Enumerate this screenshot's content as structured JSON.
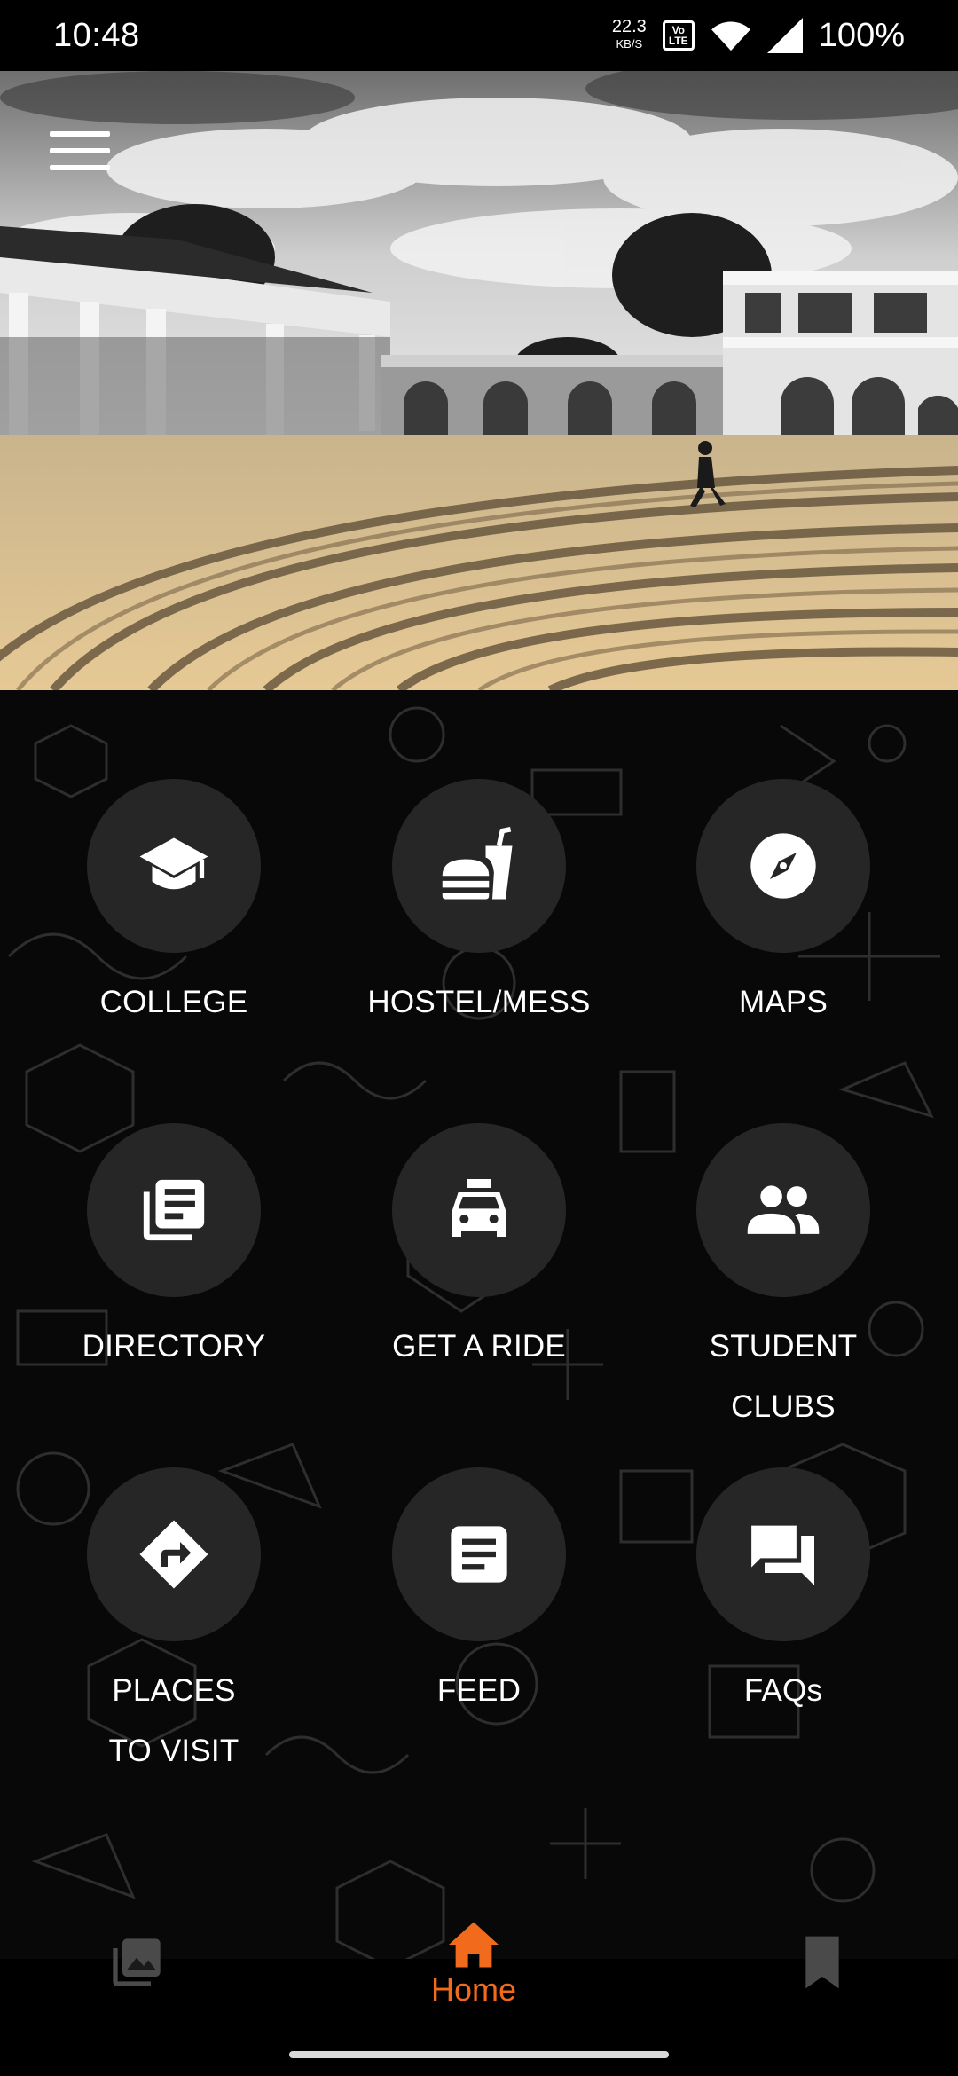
{
  "status_bar": {
    "time": "10:48",
    "net_speed_value": "22.3",
    "net_speed_unit": "KB/S",
    "volte_top": "Vo",
    "volte_bottom": "LTE",
    "battery": "100%"
  },
  "hero": {
    "menu_icon": "hamburger-menu-icon"
  },
  "grid": {
    "items": [
      {
        "label": "COLLEGE",
        "icon": "graduation-cap-icon"
      },
      {
        "label": "HOSTEL/MESS",
        "icon": "fastfood-icon"
      },
      {
        "label": "MAPS",
        "icon": "compass-icon"
      },
      {
        "label": "DIRECTORY",
        "icon": "library-books-icon"
      },
      {
        "label": "GET A RIDE",
        "icon": "taxi-icon"
      },
      {
        "label": "STUDENT",
        "label2": "CLUBS",
        "icon": "people-icon"
      },
      {
        "label": "PLACES",
        "label2": "TO VISIT",
        "icon": "directions-icon"
      },
      {
        "label": "FEED",
        "icon": "article-icon"
      },
      {
        "label": "FAQs",
        "icon": "forum-icon"
      }
    ]
  },
  "bottom_nav": {
    "home_label": "Home",
    "accent": "#f26b1d",
    "left_icon": "gallery-icon",
    "right_icon": "bookmark-icon"
  },
  "colors": {
    "background": "#080808",
    "tile_circle": "#262626",
    "accent": "#f26b1d"
  }
}
